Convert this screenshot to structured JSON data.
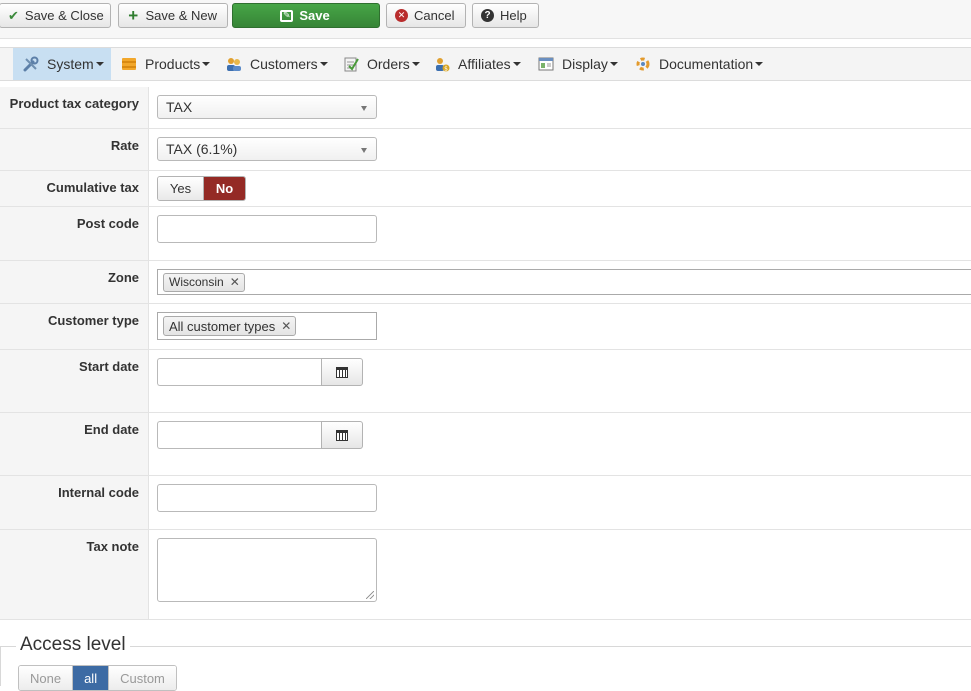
{
  "toolbar": {
    "save_close": "Save & Close",
    "save_new": "Save & New",
    "save": "Save",
    "cancel": "Cancel",
    "help": "Help"
  },
  "menu": {
    "items": [
      {
        "label": "System",
        "icon": "tools-icon"
      },
      {
        "label": "Products",
        "icon": "box-icon"
      },
      {
        "label": "Customers",
        "icon": "users-icon"
      },
      {
        "label": "Orders",
        "icon": "orders-icon"
      },
      {
        "label": "Affiliates",
        "icon": "affiliates-icon"
      },
      {
        "label": "Display",
        "icon": "display-icon"
      },
      {
        "label": "Documentation",
        "icon": "documentation-icon"
      }
    ],
    "active": "System"
  },
  "form": {
    "product_tax_category": {
      "label": "Product tax category",
      "value": "TAX"
    },
    "rate": {
      "label": "Rate",
      "value": "TAX (6.1%)"
    },
    "cumulative_tax": {
      "label": "Cumulative tax",
      "yes": "Yes",
      "no": "No",
      "selected": "No"
    },
    "post_code": {
      "label": "Post code",
      "value": ""
    },
    "zone": {
      "label": "Zone",
      "tags": [
        "Wisconsin"
      ]
    },
    "customer_type": {
      "label": "Customer type",
      "tags": [
        "All customer types"
      ]
    },
    "start_date": {
      "label": "Start date",
      "value": ""
    },
    "end_date": {
      "label": "End date",
      "value": ""
    },
    "internal_code": {
      "label": "Internal code",
      "value": ""
    },
    "tax_note": {
      "label": "Tax note",
      "value": ""
    }
  },
  "access_level": {
    "legend": "Access level",
    "options": [
      "None",
      "all",
      "Custom"
    ],
    "selected": "all"
  },
  "colors": {
    "save_green": "#46a546",
    "no_active_red": "#942a25",
    "menu_active": "#c8dff2",
    "access_selected": "#3d6ba4"
  }
}
